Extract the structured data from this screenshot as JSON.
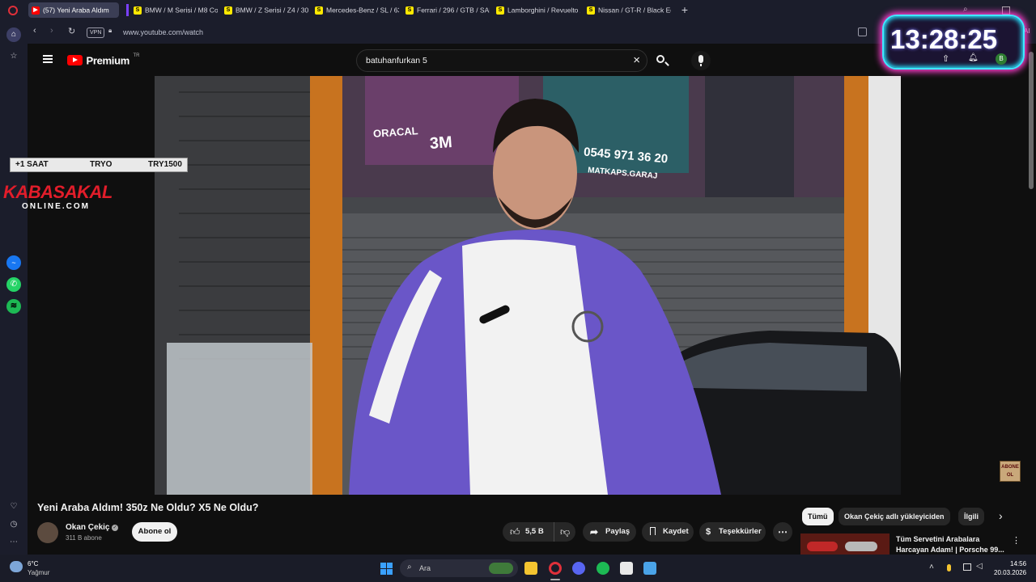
{
  "tabs": [
    {
      "label": "(57) Yeni Araba Aldım",
      "favicon": "youtube",
      "active": true
    },
    {
      "label": "BMW / M Serisi / M8 Cou",
      "favicon": "sahibinden"
    },
    {
      "label": "BMW / Z Serisi / Z4 / 30i",
      "favicon": "sahibinden"
    },
    {
      "label": "Mercedes-Benz / SL / 63",
      "favicon": "sahibinden"
    },
    {
      "label": "Ferrari / 296 / GTB / SANT",
      "favicon": "sahibinden"
    },
    {
      "label": "Lamborghini / Revuelto /",
      "favicon": "sahibinden"
    },
    {
      "label": "Nissan / GT-R / Black Editi",
      "favicon": "sahibinden"
    }
  ],
  "address": {
    "vpn_label": "VPN",
    "url": "www.youtube.com/watch",
    "ai_label": "AI"
  },
  "youtube": {
    "logo_text": "Premium",
    "logo_sup": "TR",
    "search_value": "batuhanfurkan 5",
    "video_title": "Yeni Araba Aldım! 350z Ne Oldu? X5 Ne Oldu?",
    "channel_name": "Okan Çekiç",
    "subscribers": "311 B abone",
    "subscribe_label": "Abone ol",
    "like_count": "5,5 B",
    "share_label": "Paylaş",
    "save_label": "Kaydet",
    "thanks_label": "Teşekkürler",
    "chips": [
      "Tümü",
      "Okan Çekiç adlı yükleyiciden",
      "İlgili"
    ],
    "related_title_line1": "Tüm Servetini Arabalara",
    "related_title_line2": "Harcayan Adam! | Porsche 99..."
  },
  "video_overlay": {
    "banner": [
      "+1 SAAT",
      "TRYO",
      "TRY1500"
    ],
    "brand_top": "KABASAKAL",
    "brand_bottom": "ONLINE.COM",
    "subscribe_badge_line1": "ABONE",
    "subscribe_badge_line2": "OL",
    "sign_phone": "0545 971 36 20",
    "sign_handle": "MATKAPS.GARAJ",
    "sign_brand1": "ORACAL",
    "sign_brand2": "3M"
  },
  "clock_overlay": {
    "time": "13:28:25",
    "avatar_letter": "B"
  },
  "taskbar": {
    "weather_temp": "6°C",
    "weather_desc": "Yağmur",
    "search_placeholder": "Ara",
    "time": "14:56",
    "date": "20.03.2026"
  },
  "colors": {
    "accent_red": "#ff0000",
    "chip_active": "#f1f1f1",
    "tab_bg": "#1b1d2b",
    "clock_glow": "#ff3fd0"
  }
}
